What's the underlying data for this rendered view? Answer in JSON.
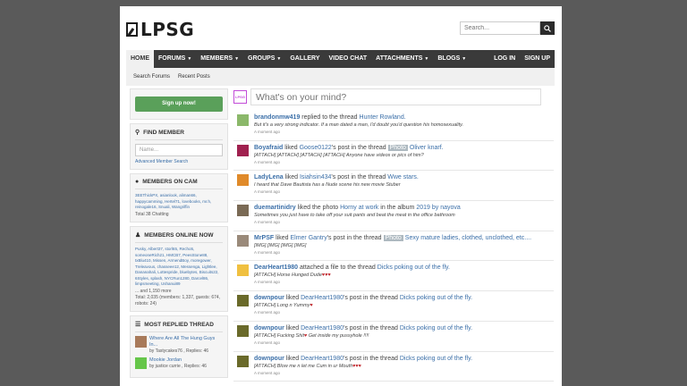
{
  "header": {
    "logo": "LPSG",
    "search_placeholder": "Search..."
  },
  "nav": {
    "left": [
      {
        "label": "HOME",
        "caret": false
      },
      {
        "label": "FORUMS",
        "caret": true
      },
      {
        "label": "MEMBERS",
        "caret": true
      },
      {
        "label": "GROUPS",
        "caret": true
      },
      {
        "label": "GALLERY",
        "caret": false
      },
      {
        "label": "VIDEO CHAT",
        "caret": false
      },
      {
        "label": "ATTACHMENTS",
        "caret": true
      },
      {
        "label": "BLOGS",
        "caret": true
      }
    ],
    "right": [
      "LOG IN",
      "SIGN UP"
    ],
    "sub": [
      "Search Forums",
      "Recent Posts"
    ]
  },
  "sidebar": {
    "signup": "Sign up now!",
    "find_member": {
      "title": "FIND MEMBER",
      "placeholder": "Name...",
      "link": "Advanced Member Search"
    },
    "members_on_cam": {
      "title": "MEMBERS ON CAM",
      "names": "3EEThickPX, asianlook, aliman66, happycamming, Hertel71, lovebooks, mr.h, reinogale16, Snuali, Wangriffin",
      "total": "Total 38 Chatting"
    },
    "members_online": {
      "title": "MEMBERS ONLINE NOW",
      "names": "Pusky, Albert37, storl65, Recho5, someoneRich21, HMCB7, PeesStone88, txBlu410, Missen, ArmendBoy, moregower, Treleavous, chasseee12, Messenga, Lightlee, Dananahali, Lottespride, bluebytes, Biscuits22, 6Styles, splash, NYCRun1280, Darcel86, limpsmeeting, Ushanui89",
      "more": "... and 1,150 more",
      "total": "Total: 2,035 (members: 1,337, guests: 674, robots: 24)"
    },
    "most_replied": {
      "title": "MOST REPLIED THREAD",
      "items": [
        {
          "title": "Where Are All The Hung Guys In...",
          "meta": "by Tastycakes76 , Replies: 46"
        },
        {
          "title": "Mookie Jordan",
          "meta": "by justice currie , Replies: 46"
        }
      ]
    }
  },
  "main": {
    "status_avatar": "LPSG",
    "status_placeholder": "What's on your mind?",
    "feed": [
      {
        "user": "brandonmw419",
        "action": " replied to the thread ",
        "tag": "",
        "target": "Hunter Rowland.",
        "quote": "But it's a very strong indicator. If a man dated a man, I'd doubt you'd question his homosexuality.",
        "hearts": "",
        "time": "A moment ago",
        "avatar_color": "#8bb86a"
      },
      {
        "user": "Boyafraid",
        "action": " liked ",
        "link1": "Goose0122",
        "action2": "'s post in the thread ",
        "tag": "Photo",
        "target": "Oliver knarf.",
        "quote": "[ATTACH] [ATTACH] [ATTACH] [ATTACH] Anyone have videos or pics of him?",
        "hearts": "",
        "time": "A moment ago",
        "avatar_color": "#a0214f"
      },
      {
        "user": "LadyLena",
        "action": " liked ",
        "link1": "Isiahsin434",
        "action2": "'s post in the thread ",
        "tag": "",
        "target": "Wwe stars.",
        "quote": "I heard that Dave Bautista has a Nude scene his new movie Stuber",
        "hearts": "",
        "time": "A moment ago",
        "avatar_color": "#e08a2a"
      },
      {
        "user": "duemartinidry",
        "action": " liked the photo ",
        "link1": "Horny at work",
        "action2": " in the album ",
        "tag": "",
        "target": "2019 by nayova",
        "quote": "Sometimes you just have to take off your suit pants and beat the meat in the office bathroom",
        "hearts": "",
        "time": "A moment ago",
        "avatar_color": "#7a6a55"
      },
      {
        "user": "MrPSF",
        "action": " liked ",
        "link1": "Elmer Gantry",
        "action2": "'s post in the thread ",
        "tag": "Photo",
        "target": "Sexy mature ladies, clothed, unclothed, etc....",
        "quote": "[IMG] [IMG] [IMG] [IMG]",
        "hearts": "",
        "time": "A moment ago",
        "avatar_color": "#9a8a7a"
      },
      {
        "user": "DearHeart1980",
        "action": " attached a file to the thread ",
        "tag": "",
        "target": "Dicks poking out of the fly.",
        "quote": "[ATTACH] Horse Hunged Dude",
        "hearts": "♥♥♥",
        "time": "A moment ago",
        "avatar_color": "#f0c040"
      },
      {
        "user": "downpour",
        "action": " liked ",
        "link1": "DearHeart1980",
        "action2": "'s post in the thread ",
        "tag": "",
        "target": "Dicks poking out of the fly.",
        "quote": "[ATTACH] Long n Yummy",
        "hearts": "♥",
        "time": "A moment ago",
        "avatar_color": "#6a6a2a"
      },
      {
        "user": "downpour",
        "action": " liked ",
        "link1": "DearHeart1980",
        "action2": "'s post in the thread ",
        "tag": "",
        "target": "Dicks poking out of the fly.",
        "quote": "[ATTACH] Fucking Shit",
        "quote2": " Get inside my pussyhole !!!!",
        "hearts": "♥",
        "time": "A moment ago",
        "avatar_color": "#6a6a2a"
      },
      {
        "user": "downpour",
        "action": " liked ",
        "link1": "DearHeart1980",
        "action2": "'s post in the thread ",
        "tag": "",
        "target": "Dicks poking out of the fly.",
        "quote": "[ATTACH] Blow me n let me Cum in ur Mouth",
        "hearts": "♥♥♥",
        "time": "A moment ago",
        "avatar_color": "#6a6a2a"
      }
    ]
  }
}
